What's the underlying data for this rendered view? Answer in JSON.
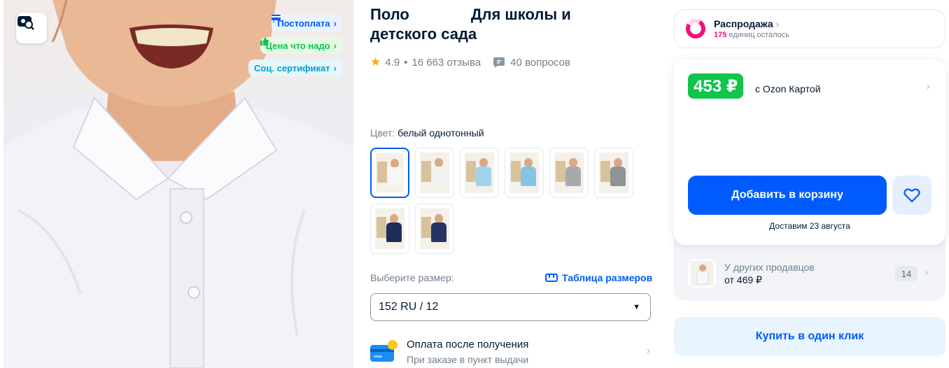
{
  "photo": {
    "badges": [
      {
        "icon": "cart-icon",
        "label": "Постоплата",
        "color": "#005bff"
      },
      {
        "icon": "thumbs-up-icon",
        "label": "Цена что надо",
        "color": "#10c44c"
      },
      {
        "icon": "",
        "label": "Соц. сертификат",
        "color": "#00a2c8"
      }
    ]
  },
  "product": {
    "title_part1": "Поло",
    "title_part2": "Для школы и детского сада",
    "rating": "4.9",
    "separator": "•",
    "reviews": "16 663 отзыва",
    "questions": "40 вопросов",
    "color_label": "Цвет:",
    "color_value": "белый однотонный",
    "swatches": [
      {
        "name": "white",
        "shirt": "#f6f6f6",
        "selected": true
      },
      {
        "name": "white-2",
        "shirt": "#f2f2f2"
      },
      {
        "name": "light-blue",
        "shirt": "#9fd3ea"
      },
      {
        "name": "sky-blue",
        "shirt": "#86c4e4"
      },
      {
        "name": "gray",
        "shirt": "#a7aaad"
      },
      {
        "name": "gray-2",
        "shirt": "#8f9396"
      },
      {
        "name": "navy",
        "shirt": "#1f2d59"
      },
      {
        "name": "navy-2",
        "shirt": "#263464"
      }
    ],
    "size_label": "Выберите размер:",
    "size_table_label": "Таблица размеров",
    "size_selected": "152 RU / 12",
    "payment_title": "Оплата после получения",
    "payment_sub": "При заказе в пункт выдачи"
  },
  "sale": {
    "title": "Распродажа",
    "count": "175",
    "count_text": "единиц осталось",
    "accent": "#f1117e"
  },
  "buy": {
    "price": "453 ₽",
    "price_note": "с Ozon Картой",
    "add_to_cart": "Добавить в корзину",
    "delivery": "Доставим 23 августа",
    "others_title": "У других продавцов",
    "others_price": "от 469 ₽",
    "others_count": "14",
    "one_click": "Купить в один клик",
    "accent": "#005bff",
    "price_color": "#10c44c"
  }
}
